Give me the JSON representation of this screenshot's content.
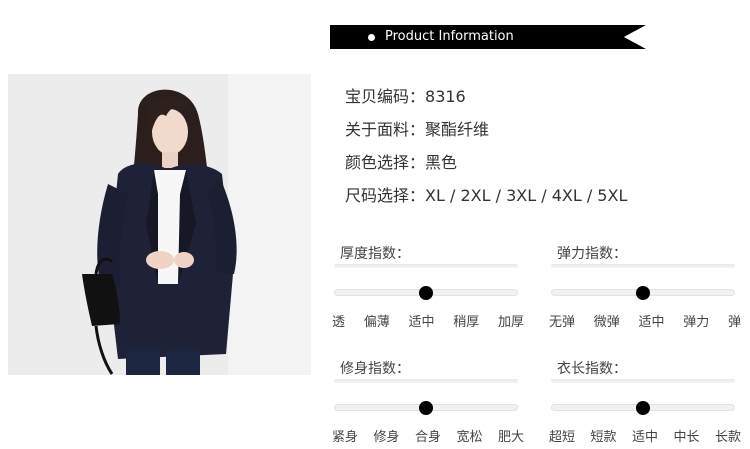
{
  "header": {
    "title": "Product Information"
  },
  "product": {
    "lines": [
      {
        "label": "宝贝编码：",
        "value": "8316"
      },
      {
        "label": "关于面料：",
        "value": "聚酯纤维"
      },
      {
        "label": "颜色选择：",
        "value": "黑色"
      },
      {
        "label": "尺码选择：",
        "value": "XL / 2XL / 3XL / 4XL / 5XL"
      }
    ]
  },
  "scales": [
    {
      "title": "厚度指数：",
      "labels": [
        "透",
        "偏薄",
        "适中",
        "稍厚",
        "加厚"
      ],
      "level": 0.5
    },
    {
      "title": "弹力指数：",
      "labels": [
        "无弹",
        "微弹",
        "适中",
        "弹力",
        "弹"
      ],
      "level": 0.5
    },
    {
      "title": "修身指数：",
      "labels": [
        "紧身",
        "修身",
        "合身",
        "宽松",
        "肥大"
      ],
      "level": 0.5
    },
    {
      "title": "衣长指数：",
      "labels": [
        "超短",
        "短款",
        "适中",
        "中长",
        "长款"
      ],
      "level": 0.5
    }
  ],
  "colors": {
    "header_bg": "#000000",
    "knob": "#000000",
    "track": "#f1f1f1"
  },
  "image": {
    "subject": "model-photo"
  }
}
